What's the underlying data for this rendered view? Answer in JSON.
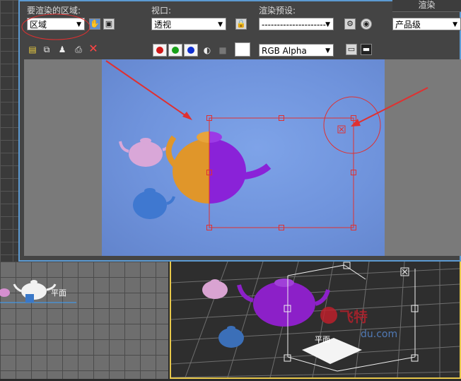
{
  "render_frame": {
    "region_label": "要渲染的区域:",
    "region_value": "区域",
    "viewport_label": "视口:",
    "viewport_value": "透视",
    "preset_label": "渲染预设:",
    "preset_value": "---------------------",
    "render_tab": "渲染",
    "quality_value": "产品级",
    "channel_value": "RGB Alpha"
  },
  "toolbar_icons": [
    "save-icon",
    "copy-icon",
    "clone-icon",
    "print-icon",
    "clear-icon"
  ],
  "channels": {
    "red": "#d01818",
    "green": "#18a018",
    "blue": "#1030d0"
  },
  "scene": {
    "left_label": "平面",
    "bottom_label": "平面",
    "watermark": "飞特",
    "watermark_sub": "du.com"
  },
  "colors": {
    "accent": "#e03030",
    "frame_border": "#5c9ad2",
    "viewport_border": "#e8c84a"
  }
}
